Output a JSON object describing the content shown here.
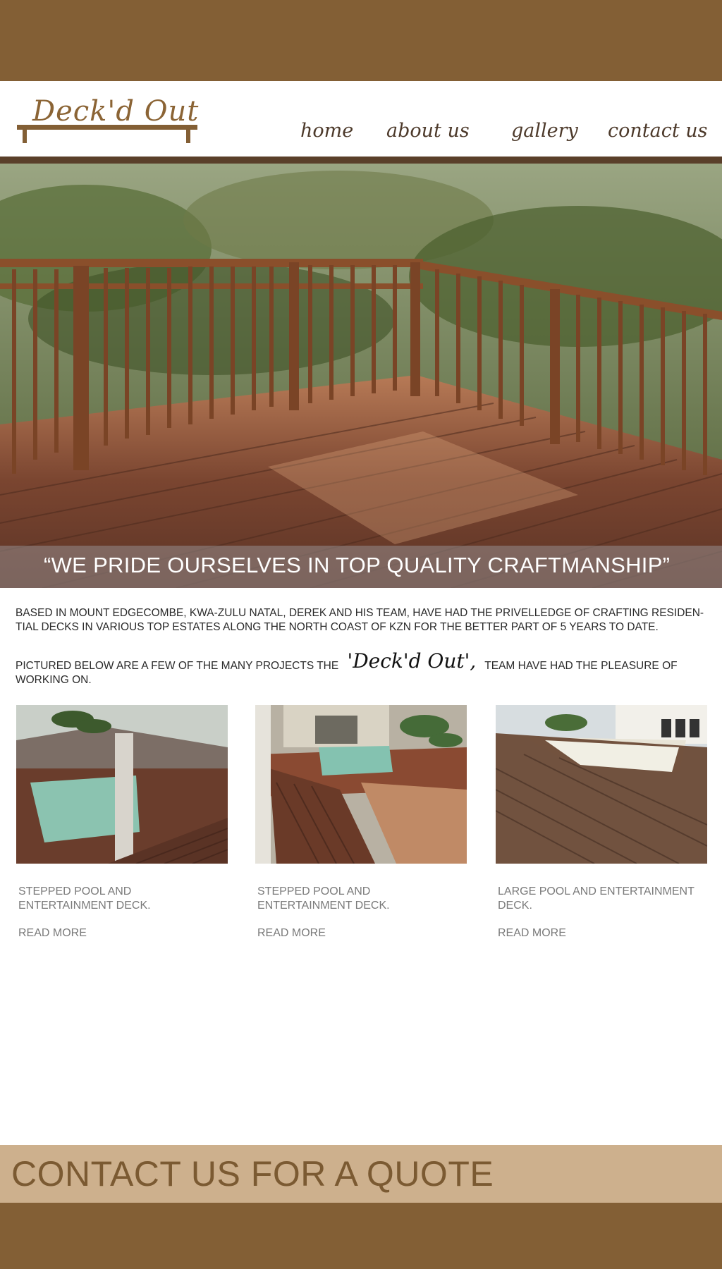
{
  "brand": {
    "logo_text": "Deck'd Out"
  },
  "nav": {
    "items": [
      {
        "label": "home"
      },
      {
        "label": "about us"
      },
      {
        "label": "gallery"
      },
      {
        "label": "contact us"
      }
    ]
  },
  "hero": {
    "caption": "“WE PRIDE OURSELVES IN TOP QUALITY CRAFTMANSHIP”"
  },
  "intro": {
    "paragraph": "BASED IN MOUNT EDGECOMBE, KWA-ZULU NATAL, DEREK AND HIS TEAM,  HAVE HAD THE PRIVELLEDGE OF CRAFTING  RESIDEN-TIAL DECKS IN VARIOUS TOP ESTATES ALONG THE NORTH COAST OF KZN FOR THE BETTER PART OF 5 YEARS TO DATE.",
    "projects_before": "PICTURED BELOW ARE A FEW OF THE MANY PROJECTS THE",
    "projects_brand": "'Deck'd Out',",
    "projects_after": "TEAM HAVE HAD THE PLEASURE OF WORKING ON."
  },
  "projects": [
    {
      "title": "STEPPED POOL AND ENTERTAINMENT DECK.",
      "read_more": "READ MORE"
    },
    {
      "title": "STEPPED POOL AND ENTERTAINMENT DECK.",
      "read_more": "READ MORE"
    },
    {
      "title": "LARGE POOL AND ENTERTAINMENT DECK.",
      "read_more": "READ MORE"
    }
  ],
  "cta": {
    "label": "CONTACT US FOR A QUOTE"
  },
  "colors": {
    "brand_brown": "#835f35",
    "header_rule": "#5a3f2a",
    "cta_tan": "#cdb08d",
    "cta_text": "#7b5a32"
  },
  "icons": [
    "deck-table-logo-icon"
  ]
}
